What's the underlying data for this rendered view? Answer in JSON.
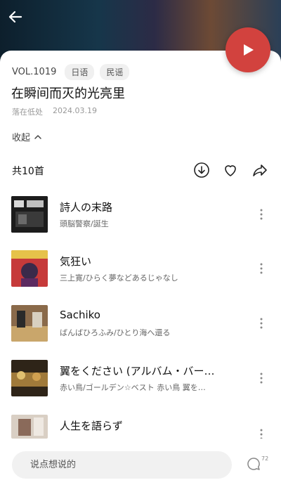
{
  "header": {
    "back_icon": "back-arrow-icon",
    "play_icon": "play-icon",
    "play_color": "#d2423e"
  },
  "playlist": {
    "volume": "VOL.1019",
    "tags": [
      "日语",
      "民谣"
    ],
    "title": "在瞬间而灭的光亮里",
    "author": "落在低处",
    "date": "2024.03.19",
    "collapse_label": "收起",
    "count_label": "共10首"
  },
  "tracks": [
    {
      "name": "詩人の末路",
      "artist": "頭脳警察/誕生"
    },
    {
      "name": "気狂い",
      "artist": "三上寛/ひらく夢などあるじゃなし"
    },
    {
      "name": "Sachiko",
      "artist": "ばんばひろふみ/ひとり海へ還る"
    },
    {
      "name": "翼をください (アルバム・バー…",
      "artist": "赤い鳥/ゴールデン☆ベスト 赤い鳥 翼を…"
    },
    {
      "name": "人生を語らず",
      "artist": ""
    }
  ],
  "comment": {
    "placeholder": "说点想说的",
    "count": "72"
  }
}
